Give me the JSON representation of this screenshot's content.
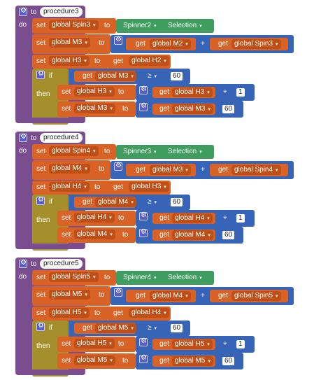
{
  "labels": {
    "to": "to",
    "do": "do",
    "set": "set",
    "get": "get",
    "if": "if",
    "then": "then",
    "kw_to": "to",
    "plus": "+",
    "minus": "-",
    "gte": "≥"
  },
  "procs": [
    {
      "name": "procedure3",
      "spinner": "Spinner2",
      "selection": "Selection",
      "spin": "global Spin3",
      "m": "global M3",
      "h": "global H3",
      "m_get": "global M2",
      "h_get": "global H2",
      "threshold": "60",
      "inc": "1",
      "dec": "60"
    },
    {
      "name": "procedure4",
      "spinner": "Spinner3",
      "selection": "Selection",
      "spin": "global Spin4",
      "m": "global M4",
      "h": "global H4",
      "m_get": "global M3",
      "h_get": "global H3",
      "threshold": "60",
      "inc": "1",
      "dec": "60"
    },
    {
      "name": "procedure5",
      "spinner": "Spinner4",
      "selection": "Selection",
      "spin": "global Spin5",
      "m": "global M5",
      "h": "global H5",
      "m_get": "global M4",
      "h_get": "global H4",
      "threshold": "60",
      "inc": "1",
      "dec": "60"
    }
  ],
  "colors": {
    "procedure": "#7a4e8e",
    "variable": "#d96226",
    "math": "#3864b8",
    "component": "#3f9e5f",
    "control": "#a58f2c"
  }
}
